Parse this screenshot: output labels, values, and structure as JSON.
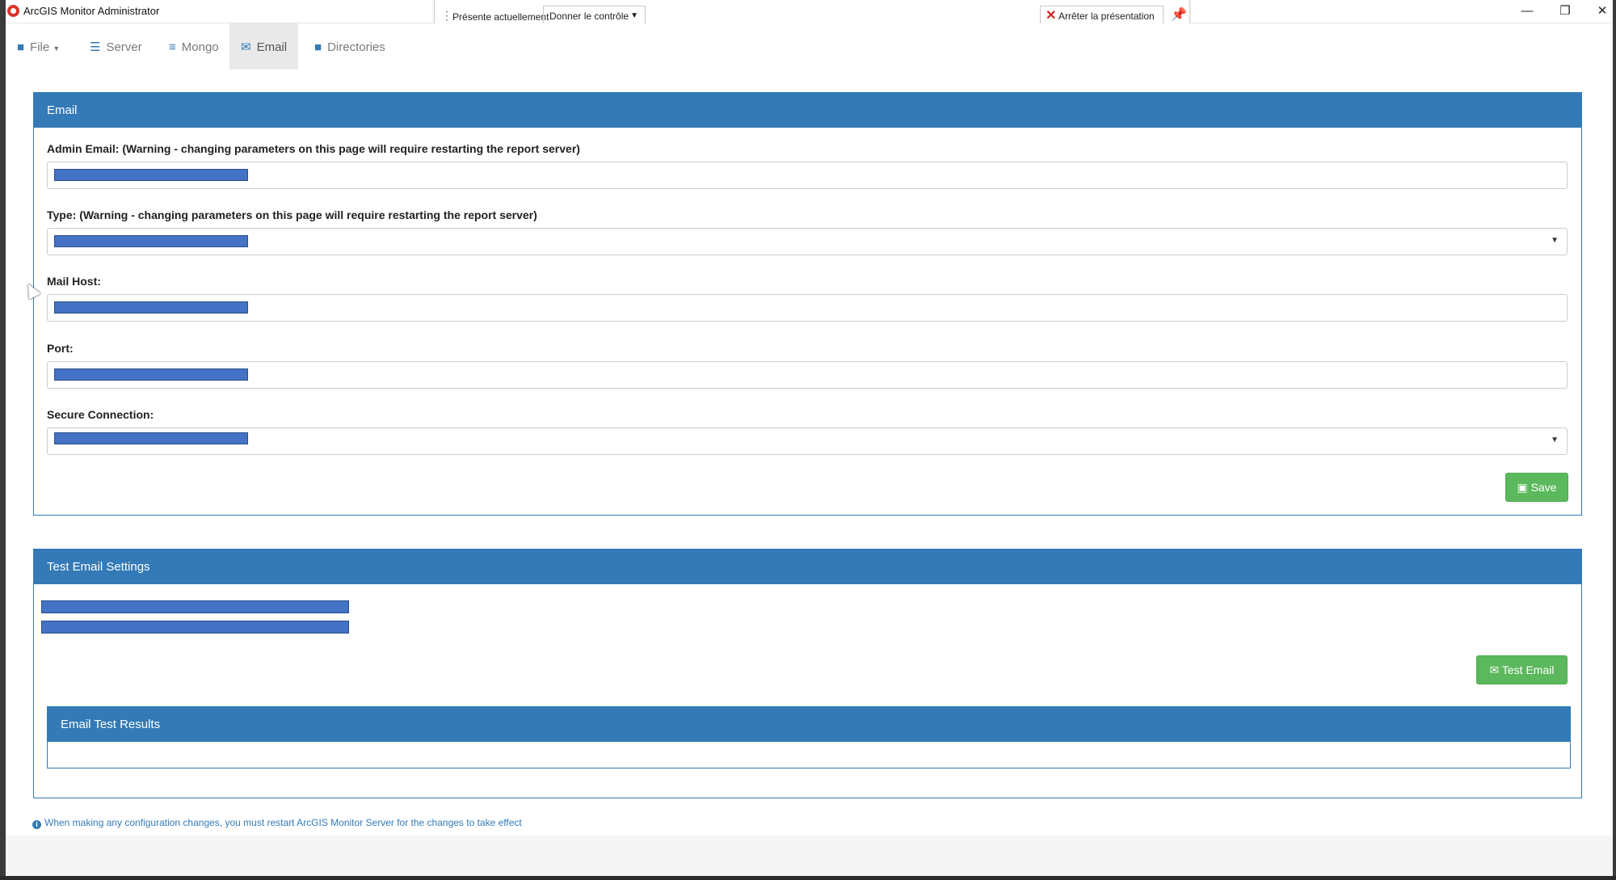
{
  "window": {
    "title": "ArcGIS Monitor Administrator",
    "minimize": "—",
    "restore": "❐",
    "close": "✕"
  },
  "presenter": {
    "status": "Présente actuellement",
    "give_control": "Donner le contrôle",
    "stop": "Arrêter la présentation"
  },
  "nav": {
    "file": "File",
    "server": "Server",
    "mongo": "Mongo",
    "email": "Email",
    "directories": "Directories",
    "active": "Email"
  },
  "email_panel": {
    "title": "Email",
    "admin_email_label": "Admin Email: (Warning - changing parameters on this page will require restarting the report server)",
    "type_label": "Type: (Warning - changing parameters on this page will require restarting the report server)",
    "mail_host_label": "Mail Host:",
    "port_label": "Port:",
    "secure_connection_label": "Secure Connection:",
    "save_label": "Save"
  },
  "test_panel": {
    "title": "Test Email Settings",
    "test_button": "Test Email",
    "results_title": "Email Test Results"
  },
  "footer": {
    "note": "When making any configuration changes, you must restart ArcGIS Monitor Server for the changes to take effect"
  },
  "colors": {
    "primary": "#337ab7",
    "success": "#5cb85c",
    "redaction": "#4472c4"
  }
}
